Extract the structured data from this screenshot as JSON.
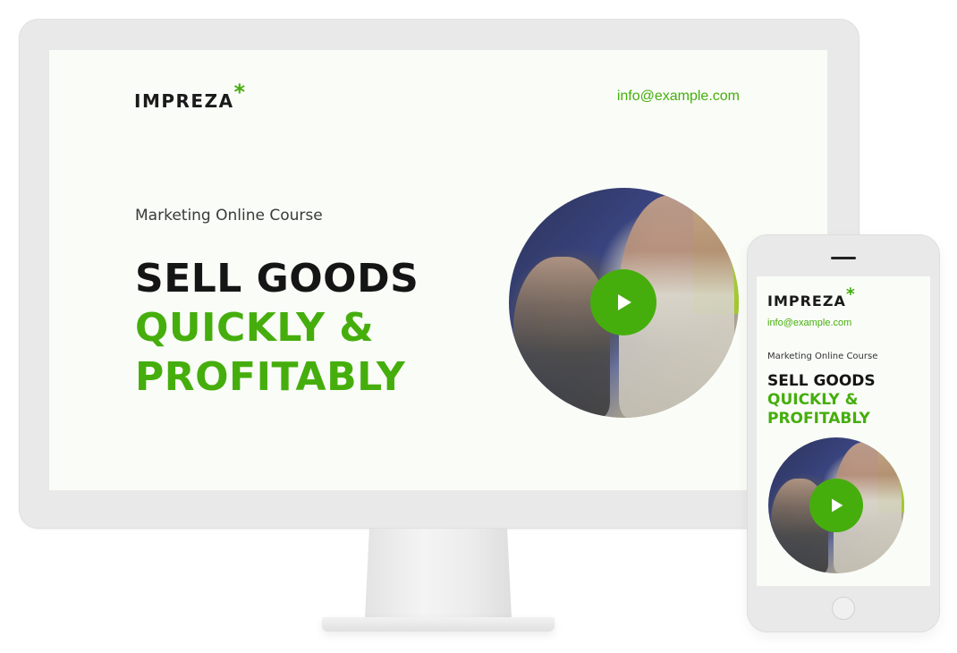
{
  "brand": {
    "name": "IMPREZA",
    "accent_glyph": "*",
    "accent_color": "#45ae0d",
    "text_color": "#151515",
    "background": "#fafcf7"
  },
  "header": {
    "email": "info@example.com"
  },
  "hero": {
    "kicker": "Marketing Online Course",
    "headline_line1": "SELL GOODS",
    "headline_line2": "QUICKLY &",
    "headline_line3": "PROFITABLY"
  },
  "video": {
    "play_icon": "play-icon"
  },
  "devices": [
    "desktop-monitor",
    "mobile-phone"
  ]
}
